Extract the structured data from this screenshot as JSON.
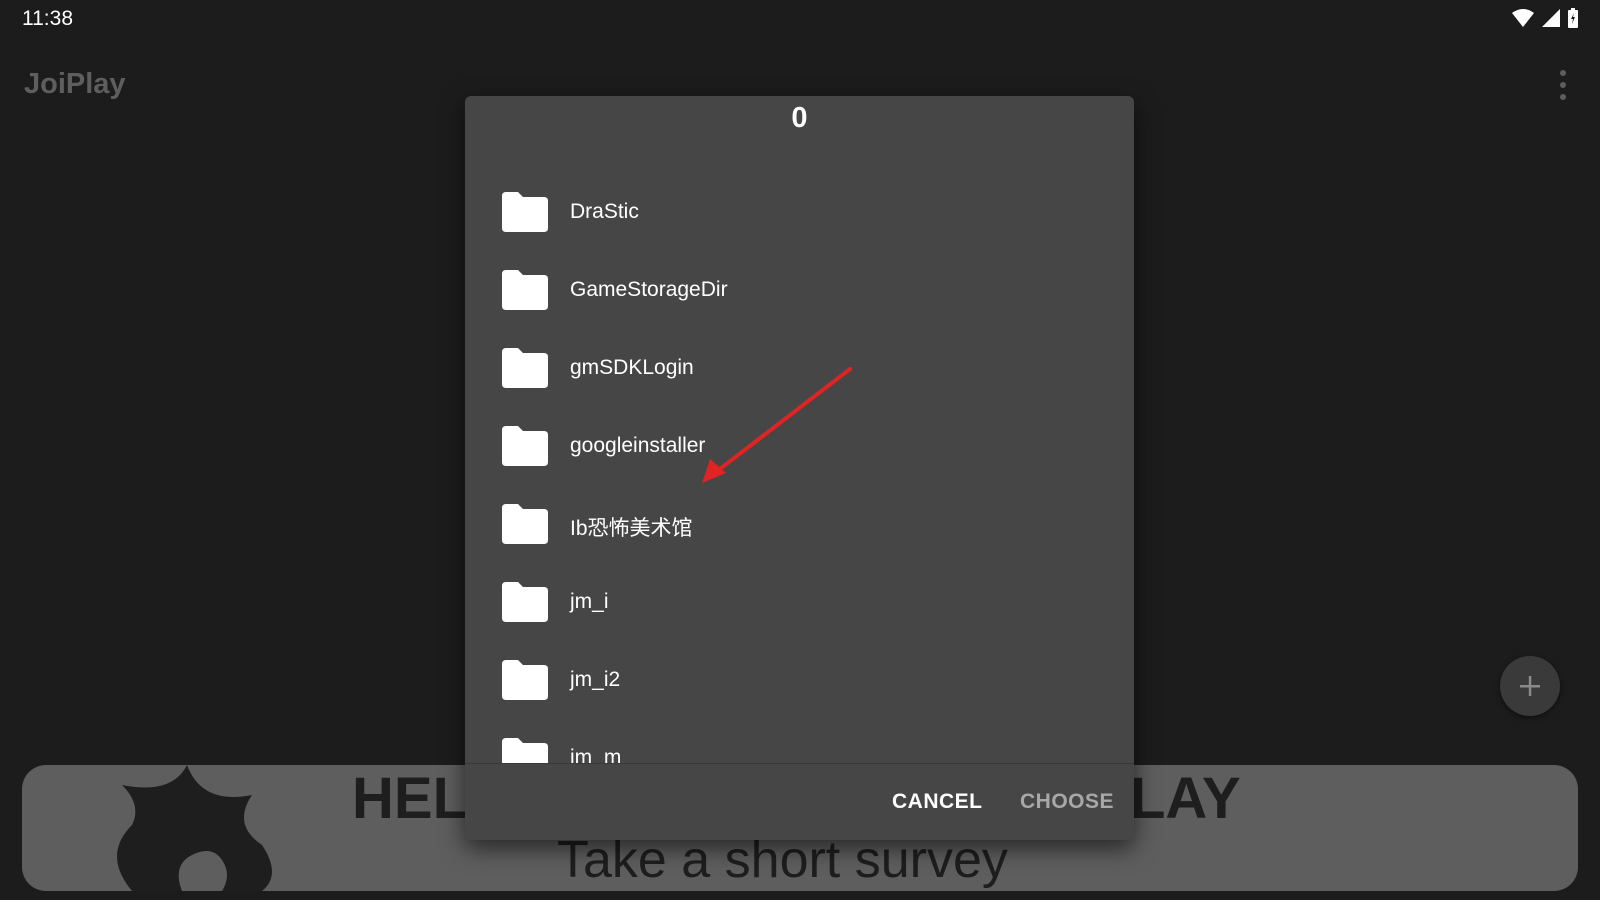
{
  "status": {
    "time": "11:38"
  },
  "app": {
    "title": "JoiPlay"
  },
  "banner": {
    "left_text": "HEL",
    "right_text": "LAY",
    "subtitle": "Take a short survey"
  },
  "dialog": {
    "title": "0",
    "folders": [
      {
        "name": "DraStic"
      },
      {
        "name": "GameStorageDir"
      },
      {
        "name": "gmSDKLogin"
      },
      {
        "name": "googleinstaller"
      },
      {
        "name": "Ib恐怖美术馆"
      },
      {
        "name": "jm_i"
      },
      {
        "name": "jm_i2"
      },
      {
        "name": "jm_m"
      }
    ],
    "cancel_label": "CANCEL",
    "choose_label": "CHOOSE"
  },
  "icons": {
    "folder": "folder-icon",
    "fab": "plus-icon",
    "menu": "more-vert-icon",
    "annotation_color": "#e02424"
  }
}
